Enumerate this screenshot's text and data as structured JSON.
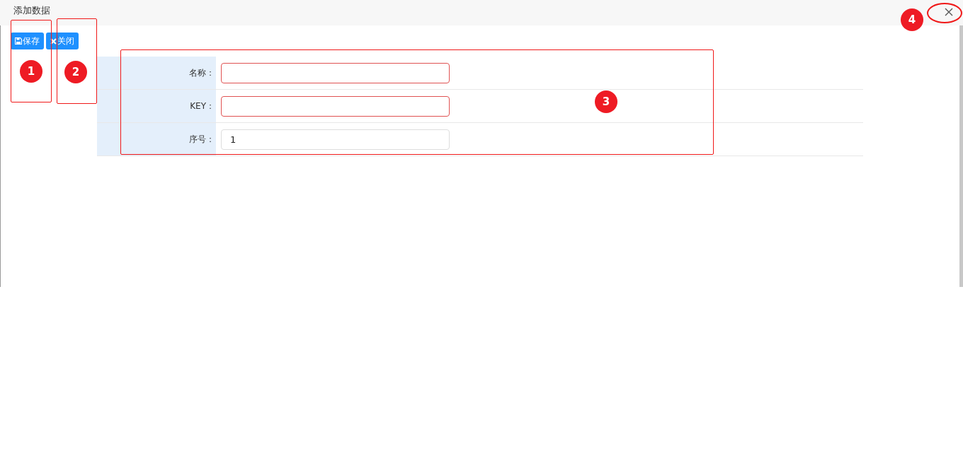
{
  "window": {
    "title": "添加数据"
  },
  "toolbar": [
    {
      "label": "保存",
      "kind": "save"
    },
    {
      "label": "关闭",
      "kind": "close"
    }
  ],
  "form": {
    "rows": [
      {
        "label": "名称：",
        "value": "",
        "invalid": true
      },
      {
        "label": "KEY：",
        "value": "",
        "invalid": true
      },
      {
        "label": "序号：",
        "value": "1",
        "invalid": false
      }
    ]
  },
  "annotations": [
    {
      "label": "1",
      "kind": "box"
    },
    {
      "label": "2",
      "kind": "box"
    },
    {
      "label": "3",
      "kind": "box"
    },
    {
      "label": "4",
      "kind": "ellipse"
    }
  ]
}
